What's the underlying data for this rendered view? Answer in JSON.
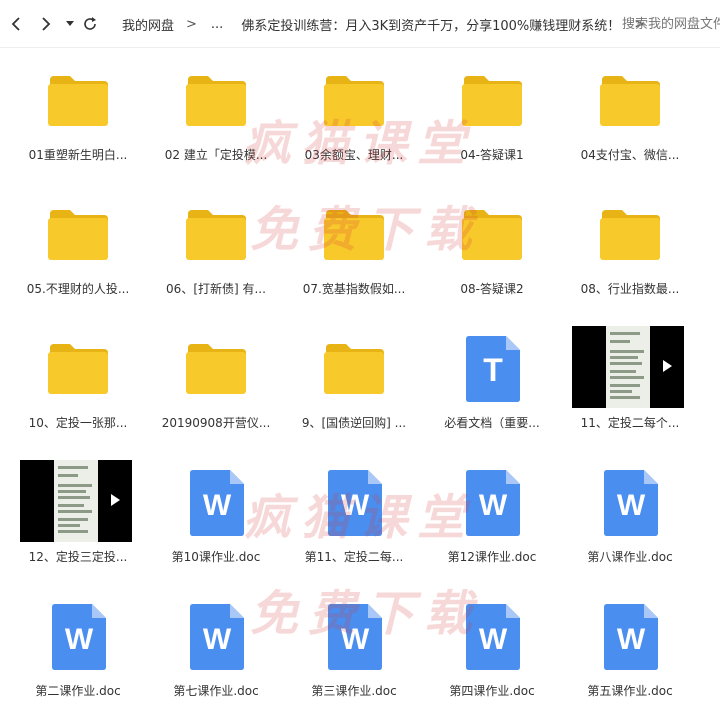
{
  "toolbar": {
    "breadcrumb_root": "我的网盘",
    "breadcrumb_ellipsis": "...",
    "breadcrumb_current": "佛系定投训练营：月入3K到资产千万，分享100%赚钱理财系统！",
    "search_placeholder": "搜索我的网盘文件",
    "icons": [
      "back-arrow-icon",
      "forward-arrow-icon",
      "dropdown-caret-icon",
      "refresh-icon",
      "chevron-right-icon"
    ]
  },
  "watermark": {
    "line1": "疯猫课堂",
    "line2": "免费下载"
  },
  "files": [
    {
      "name": "01重塑新生明白...",
      "type": "folder"
    },
    {
      "name": "02 建立「定投模...",
      "type": "folder"
    },
    {
      "name": "03余额宝、理财...",
      "type": "folder"
    },
    {
      "name": "04-答疑课1",
      "type": "folder"
    },
    {
      "name": "04支付宝、微信...",
      "type": "folder"
    },
    {
      "name": "05.不理财的人投...",
      "type": "folder"
    },
    {
      "name": "06、[打新债] 有...",
      "type": "folder"
    },
    {
      "name": "07.宽基指数假如...",
      "type": "folder"
    },
    {
      "name": "08-答疑课2",
      "type": "folder"
    },
    {
      "name": "08、行业指数最...",
      "type": "folder"
    },
    {
      "name": "10、定投一张那...",
      "type": "folder"
    },
    {
      "name": "20190908开营仪...",
      "type": "folder"
    },
    {
      "name": "9、[国债逆回购] ...",
      "type": "folder"
    },
    {
      "name": "必看文档（重要...",
      "type": "text"
    },
    {
      "name": "11、定投二每个...",
      "type": "video"
    },
    {
      "name": "12、定投三定投...",
      "type": "video"
    },
    {
      "name": "第10课作业.doc",
      "type": "word"
    },
    {
      "name": "第11、定投二每...",
      "type": "word"
    },
    {
      "name": "第12课作业.doc",
      "type": "word"
    },
    {
      "name": "第八课作业.doc",
      "type": "word"
    },
    {
      "name": "第二课作业.doc",
      "type": "word"
    },
    {
      "name": "第七课作业.doc",
      "type": "word"
    },
    {
      "name": "第三课作业.doc",
      "type": "word"
    },
    {
      "name": "第四课作业.doc",
      "type": "word"
    },
    {
      "name": "第五课作业.doc",
      "type": "word"
    }
  ],
  "colors": {
    "folder": "#f8c92a",
    "folder_tab": "#e8b314",
    "doc_blue": "#4a8ef0",
    "doc_fold": "#a9c8f8"
  },
  "icon_letters": {
    "word": "W",
    "text": "T"
  }
}
